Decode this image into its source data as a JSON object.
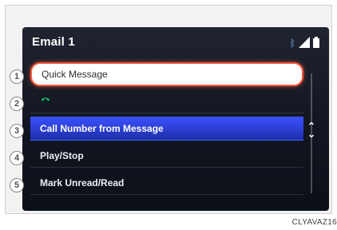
{
  "screen": {
    "title": "Email 1",
    "status_icons": [
      "bluetooth-icon",
      "signal-icon",
      "battery-icon"
    ]
  },
  "menu": {
    "items": [
      {
        "label": "Quick Message",
        "selected": true
      },
      {
        "label": "",
        "icon": "phone-icon"
      },
      {
        "label": "Call Number from Message",
        "highlighted": true
      },
      {
        "label": "Play/Stop"
      },
      {
        "label": "Mark Unread/Read"
      }
    ]
  },
  "callouts": [
    "1",
    "2",
    "3",
    "4",
    "5"
  ],
  "image_code": "CLYAVAZ16"
}
